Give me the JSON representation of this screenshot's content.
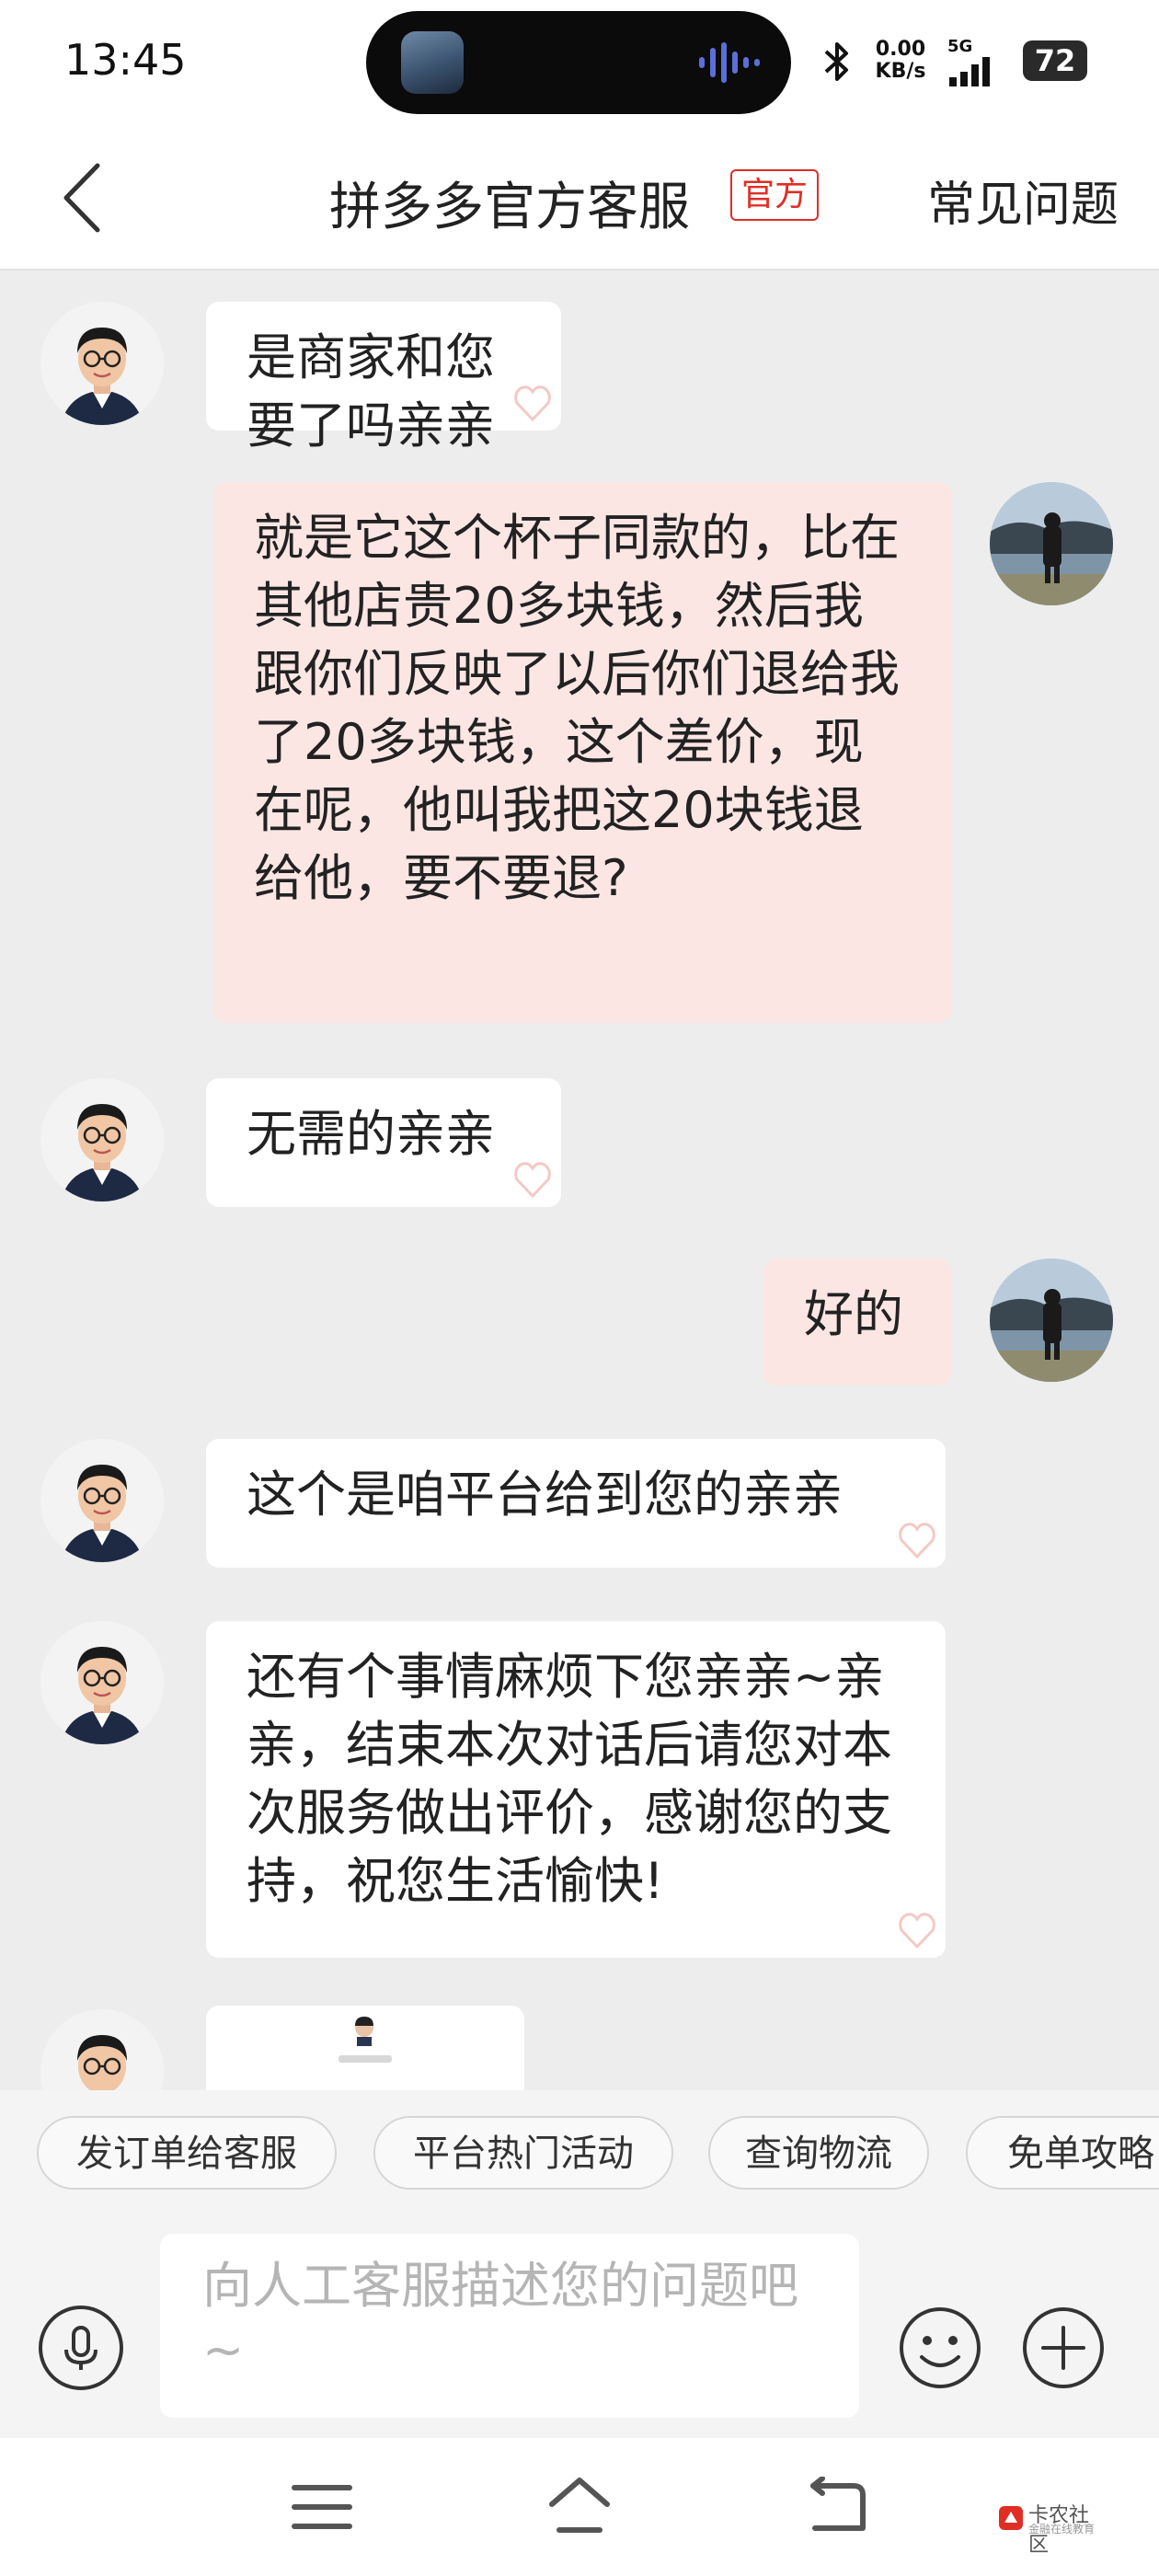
{
  "status_bar": {
    "time": "13:45",
    "net_speed_value": "0.00",
    "net_speed_unit": "KB/s",
    "network": "5G",
    "battery": "72",
    "icons": [
      "bluetooth-icon",
      "signal-icon",
      "battery-icon"
    ]
  },
  "header": {
    "title": "拼多多官方客服",
    "badge": "官方",
    "faq_label": "常见问题",
    "accent_color": "#e02e24"
  },
  "messages": [
    {
      "sender": "agent",
      "text": "是商家和您要了吗亲亲"
    },
    {
      "sender": "user",
      "text": "就是它这个杯子同款的，比在其他店贵20多块钱，然后我跟你们反映了以后你们退给我了20多块钱，这个差价，现在呢，他叫我把这20块钱退给他，要不要退?"
    },
    {
      "sender": "agent",
      "text": "无需的亲亲"
    },
    {
      "sender": "user",
      "text": "好的"
    },
    {
      "sender": "agent",
      "text": "这个是咱平台给到您的亲亲"
    },
    {
      "sender": "agent",
      "text": "还有个事情麻烦下您亲亲~亲亲，结束本次对话后请您对本次服务做出评价，感谢您的支持，祝您生活愉快!"
    },
    {
      "sender": "agent",
      "type": "card"
    }
  ],
  "quick_replies": [
    "发订单给客服",
    "平台热门活动",
    "查询物流",
    "免单攻略"
  ],
  "input": {
    "placeholder": "向人工客服描述您的问题吧~",
    "value": ""
  },
  "watermark": {
    "title": "卡农社区",
    "subtitle": "金融在线教育"
  },
  "colors": {
    "user_bubble": "#fbe6e4",
    "agent_bubble": "#ffffff",
    "chat_bg": "#ededed"
  }
}
